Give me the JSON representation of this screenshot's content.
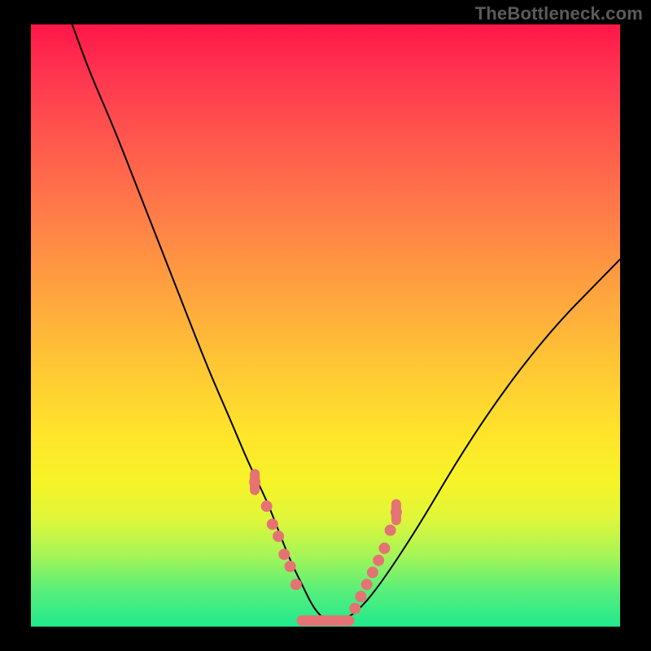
{
  "attribution": "TheBottleneck.com",
  "chart_data": {
    "type": "line",
    "title": "",
    "xlabel": "",
    "ylabel": "",
    "xlim": [
      0,
      100
    ],
    "ylim": [
      0,
      100
    ],
    "grid": false,
    "legend": false,
    "series": [
      {
        "name": "bottleneck-curve",
        "x": [
          7,
          10,
          14,
          18,
          22,
          26,
          30,
          34,
          37,
          40,
          42,
          44,
          46,
          48,
          50,
          53,
          56,
          60,
          66,
          72,
          78,
          84,
          90,
          96,
          100
        ],
        "values": [
          100,
          92,
          83,
          73,
          63,
          53,
          43,
          34,
          27,
          21,
          16,
          11,
          7,
          3,
          1,
          1,
          3,
          8,
          17,
          27,
          36,
          44,
          51,
          57,
          61
        ]
      }
    ],
    "markers": {
      "left_branch": {
        "x": [
          38,
          40,
          41,
          42,
          43,
          44,
          45
        ],
        "values": [
          24,
          20,
          17,
          15,
          12,
          10,
          7
        ]
      },
      "right_branch": {
        "x": [
          55,
          56,
          57,
          58,
          59,
          60,
          61,
          62
        ],
        "values": [
          3,
          5,
          7,
          9,
          11,
          13,
          16,
          19
        ]
      },
      "valley_pill": {
        "x_range": [
          46,
          54
        ],
        "value": 1
      },
      "left_pill": {
        "x": 38,
        "value": 24,
        "orientation": "vertical"
      },
      "right_pill": {
        "x": 62,
        "value": 19,
        "orientation": "vertical"
      }
    },
    "gradient_stops": [
      {
        "pos": 0,
        "color": "#ff1648"
      },
      {
        "pos": 8,
        "color": "#ff3450"
      },
      {
        "pos": 20,
        "color": "#ff5a4d"
      },
      {
        "pos": 32,
        "color": "#ff7e48"
      },
      {
        "pos": 44,
        "color": "#ffa23f"
      },
      {
        "pos": 56,
        "color": "#ffc535"
      },
      {
        "pos": 68,
        "color": "#ffe42b"
      },
      {
        "pos": 76,
        "color": "#f6f427"
      },
      {
        "pos": 82,
        "color": "#e0f63a"
      },
      {
        "pos": 88,
        "color": "#a8f556"
      },
      {
        "pos": 94,
        "color": "#58ef7a"
      },
      {
        "pos": 100,
        "color": "#20e98e"
      }
    ]
  }
}
